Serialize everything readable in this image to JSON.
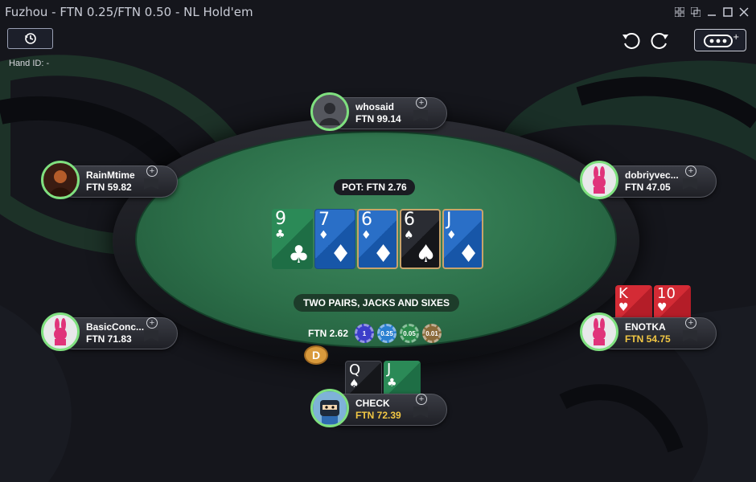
{
  "window": {
    "title": "Fuzhou - FTN 0.25/FTN 0.50 - NL Hold'em"
  },
  "toolbar": {
    "hand_id": "Hand ID: -"
  },
  "table": {
    "pot": "POT: FTN 2.76",
    "hand_description": "TWO PAIRS, JACKS AND SIXES",
    "bet_amount": "FTN 2.62",
    "chips": [
      "1",
      "0.25",
      "0.05",
      "0.01"
    ],
    "dealer_label": "D",
    "board": [
      {
        "rank": "9",
        "suit": "♣",
        "suit_class": "club"
      },
      {
        "rank": "7",
        "suit": "♦",
        "suit_class": "diamond"
      },
      {
        "rank": "6",
        "suit": "♦",
        "suit_class": "diamond"
      },
      {
        "rank": "6",
        "suit": "♠",
        "suit_class": "spade"
      },
      {
        "rank": "J",
        "suit": "♦",
        "suit_class": "diamond"
      }
    ]
  },
  "seats": [
    {
      "name": "whosaid",
      "stack": "FTN 99.14",
      "avatar": "silhouette-avatar"
    },
    {
      "name": "RainMtime",
      "stack": "FTN 59.82",
      "avatar": "photo-avatar"
    },
    {
      "name": "dobriyvec...",
      "stack": "FTN 47.05",
      "avatar": "bunny-avatar"
    },
    {
      "name": "BasicConc...",
      "stack": "FTN 71.83",
      "avatar": "bunny-avatar"
    },
    {
      "name": "ENOTKA",
      "stack": "FTN 54.75",
      "avatar": "bunny-avatar"
    },
    {
      "name": "CHECK",
      "stack": "FTN 72.39",
      "avatar": "ninja-avatar"
    }
  ],
  "hole_cards": {
    "enotka": [
      {
        "rank": "K",
        "suit": "♥",
        "suit_class": "heart"
      },
      {
        "rank": "10",
        "suit": "♥",
        "suit_class": "heart"
      }
    ],
    "hero": [
      {
        "rank": "Q",
        "suit": "♠",
        "suit_class": "spade"
      },
      {
        "rank": "J",
        "suit": "♣",
        "suit_class": "club"
      }
    ]
  },
  "colors": {
    "felt": "#2c6f49",
    "accent_green": "#7fe07f",
    "stack_gold": "#f2c744"
  }
}
